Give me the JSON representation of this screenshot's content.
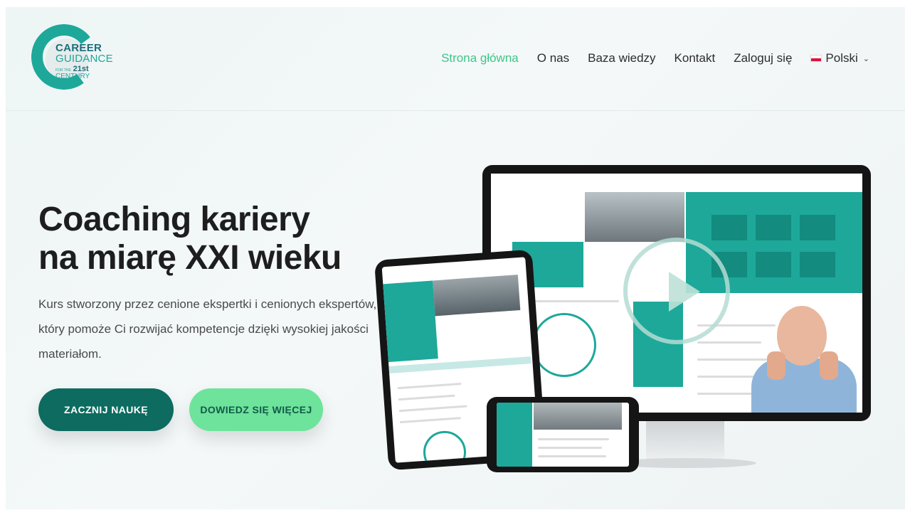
{
  "logo": {
    "line1": "CAREER",
    "line2": "GUIDANCE",
    "line3_prefix": "FOR THE",
    "line3_number": "21st",
    "line3_suffix": "CENTURY"
  },
  "nav": {
    "items": [
      {
        "label": "Strona główna",
        "active": true
      },
      {
        "label": "O nas",
        "active": false
      },
      {
        "label": "Baza wiedzy",
        "active": false
      },
      {
        "label": "Kontakt",
        "active": false
      },
      {
        "label": "Zaloguj się",
        "active": false
      }
    ],
    "language": "Polski"
  },
  "hero": {
    "title_line1": "Coaching kariery",
    "title_line2": "na miarę XXI wieku",
    "description": "Kurs stworzony przez cenione ekspertki i cenionych ekspertów, który pomoże Ci rozwijać kompetencje dzięki wysokiej jakości materiałom.",
    "primary_button": "ZACZNIJ NAUKĘ",
    "secondary_button": "DOWIEDZ SIĘ WIĘCEJ"
  },
  "colors": {
    "accent": "#3ec78a",
    "teal": "#1da89a",
    "primary_button": "#0d6b5f",
    "secondary_button": "#6ee39b"
  }
}
